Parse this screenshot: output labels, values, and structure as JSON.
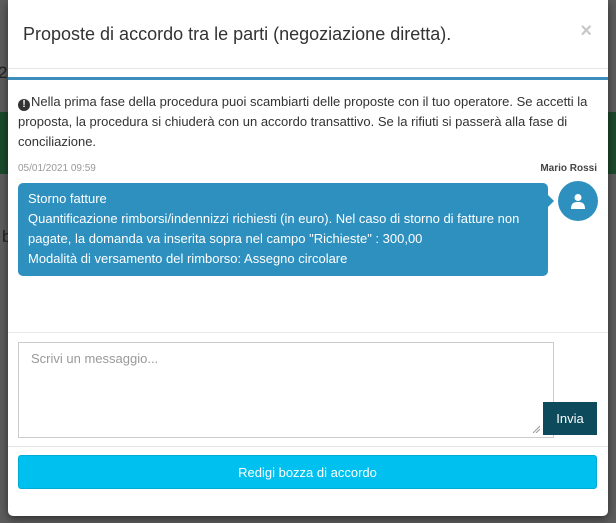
{
  "background": {
    "page_number_fragment": "2",
    "page_text_fragment": "b"
  },
  "modal": {
    "title": "Proposte di accordo tra le parti (negoziazione diretta).",
    "close_label": "×"
  },
  "info": {
    "icon": "exclamation-circle-icon",
    "text": "Nella prima fase della procedura puoi scambiarti delle proposte con il tuo operatore. Se accetti la proposta, la procedura si chiuderà con un accordo transattivo. Se la rifiuti si passerà alla fase di conciliazione."
  },
  "messages": [
    {
      "timestamp": "05/01/2021 09:59",
      "author": "Mario Rossi",
      "avatar_icon": "user-icon",
      "lines": [
        "Storno fatture",
        "Quantificazione rimborsi/indennizzi richiesti (in euro). Nel caso di storno di fatture non pagate, la domanda va inserita sopra nel campo \"Richieste\" : 300,00",
        "Modalità di versamento del rimborso: Assegno circolare"
      ]
    }
  ],
  "composer": {
    "placeholder": "Scrivi un messaggio...",
    "value": "",
    "send_label": "Invia"
  },
  "actions": {
    "draft_label": "Redigi bozza di accordo"
  },
  "colors": {
    "bubble": "#2e90bf",
    "send_button": "#0c4a5c",
    "draft_button": "#00c0ef",
    "chat_top_border": "#3c8dbc"
  }
}
